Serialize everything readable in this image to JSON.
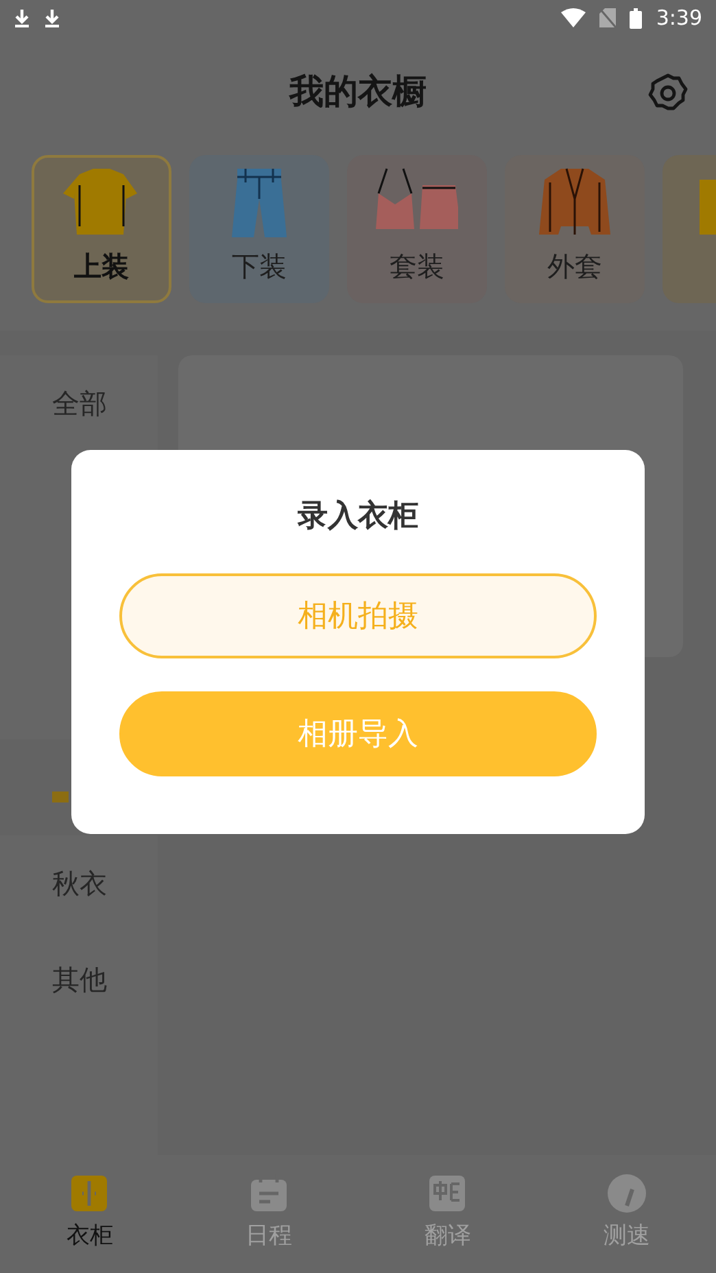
{
  "status_bar": {
    "time": "3:39"
  },
  "header": {
    "title": "我的衣橱"
  },
  "categories": [
    {
      "label": "上装",
      "selected": true,
      "color": "#6e6654"
    },
    {
      "label": "下装",
      "selected": false,
      "color": "#5e676e"
    },
    {
      "label": "套装",
      "selected": false,
      "color": "#6a6261"
    },
    {
      "label": "外套",
      "selected": false,
      "color": "#6b6561"
    },
    {
      "selected": false,
      "color": "#6e6654"
    }
  ],
  "sidebar": {
    "items": [
      {
        "label": "全部",
        "selected": false
      },
      {
        "selected": false
      },
      {
        "selected": false
      },
      {
        "selected": false
      },
      {
        "selected": true
      },
      {
        "label": "秋衣",
        "selected": false
      },
      {
        "label": "其他",
        "selected": false
      }
    ]
  },
  "dialog": {
    "title": "录入衣柜",
    "buttons": [
      {
        "label": "相机拍摄",
        "kind": "outline"
      },
      {
        "label": "相册导入",
        "kind": "filled"
      }
    ]
  },
  "tab_bar": [
    {
      "label": "衣柜",
      "selected": true
    },
    {
      "label": "日程",
      "selected": false
    },
    {
      "label": "翻译",
      "selected": false
    },
    {
      "label": "测速",
      "selected": false
    }
  ]
}
